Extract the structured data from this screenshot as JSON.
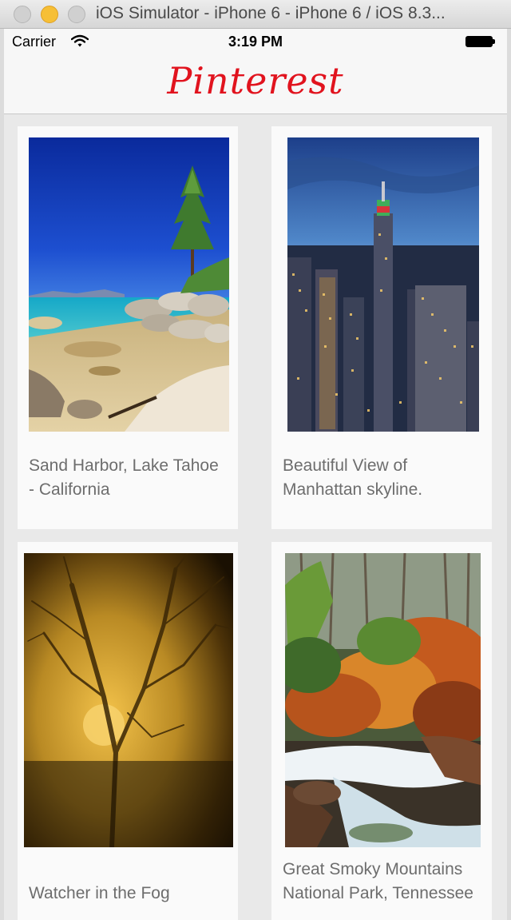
{
  "window": {
    "title": "iOS Simulator - iPhone 6 - iPhone 6 / iOS 8.3..."
  },
  "status_bar": {
    "carrier": "Carrier",
    "time": "3:19 PM"
  },
  "nav": {
    "logo": "Pinterest"
  },
  "pins": [
    {
      "caption": "Sand Harbor, Lake Tahoe - California"
    },
    {
      "caption": "Beautiful View of Manhattan skyline."
    },
    {
      "caption": "Watcher in the Fog"
    },
    {
      "caption": "Great Smoky Mountains National Park, Tennessee"
    }
  ],
  "colors": {
    "brand": "#e1131e",
    "caption": "#6d6d6d",
    "background": "#e9e9e9",
    "card": "#fafafa"
  }
}
